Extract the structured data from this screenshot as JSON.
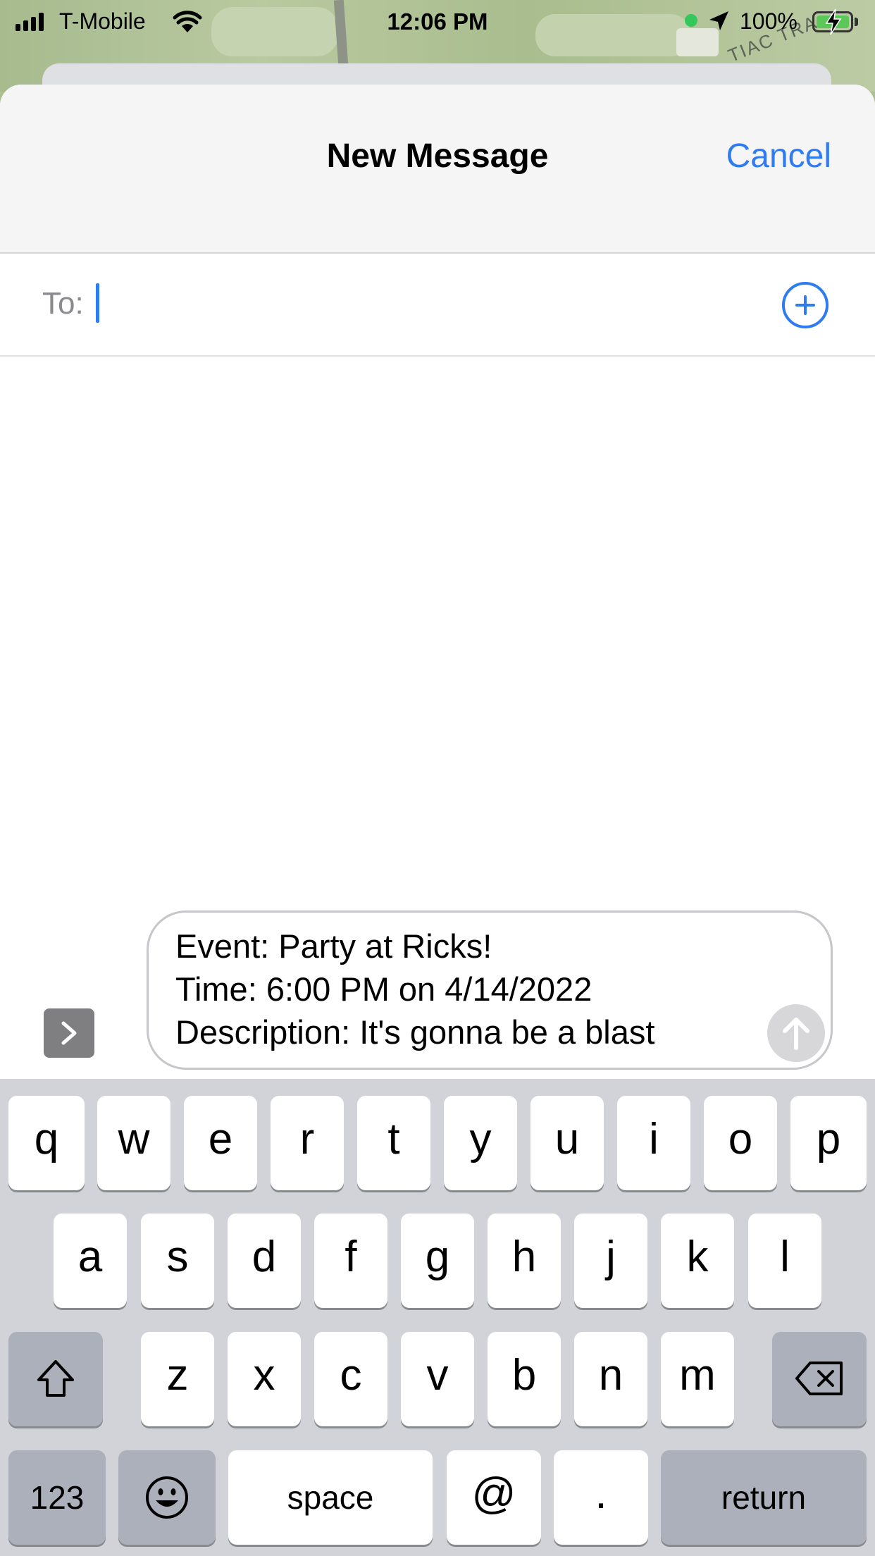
{
  "status_bar": {
    "carrier": "T-Mobile",
    "time": "12:06 PM",
    "battery": "100%",
    "battery_level": 1.0
  },
  "map": {
    "street_text": "TIAC TRA"
  },
  "nav": {
    "title": "New Message",
    "cancel_label": "Cancel"
  },
  "recipient": {
    "label": "To:",
    "value": ""
  },
  "compose": {
    "lines": [
      "Event: Party at Ricks!",
      "Time: 6:00 PM on 4/14/2022",
      "Description: It's gonna be a blast"
    ]
  },
  "keyboard": {
    "row1": [
      "q",
      "w",
      "e",
      "r",
      "t",
      "y",
      "u",
      "i",
      "o",
      "p"
    ],
    "row2": [
      "a",
      "s",
      "d",
      "f",
      "g",
      "h",
      "j",
      "k",
      "l"
    ],
    "row3": [
      "z",
      "x",
      "c",
      "v",
      "b",
      "n",
      "m"
    ],
    "numbers_label": "123",
    "space_label": "space",
    "at_label": "@",
    "period_label": ".",
    "return_label": "return"
  },
  "icons": {
    "signal": "cellular-signal-icon",
    "wifi": "wifi-icon",
    "location": "location-arrow-icon",
    "battery": "battery-charging-icon",
    "add": "plus-circle-icon",
    "expand": "chevron-right-icon",
    "send": "arrow-up-icon",
    "shift": "shift-icon",
    "delete": "delete-backspace-icon",
    "emoji": "emoji-smiley-icon"
  }
}
